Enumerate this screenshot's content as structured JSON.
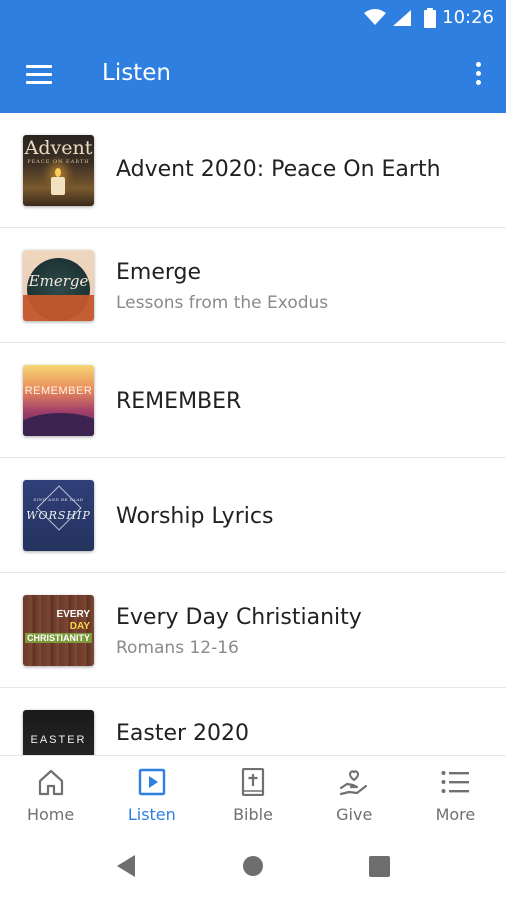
{
  "status_bar": {
    "time": "10:26"
  },
  "app_bar": {
    "title": "Listen",
    "menu_icon": "hamburger-menu-icon",
    "overflow_icon": "more-vert-icon"
  },
  "list": {
    "items": [
      {
        "title": "Advent 2020: Peace On Earth",
        "subtitle": "",
        "thumb_text": "Advent",
        "thumb_subtext": "PEACE ON EARTH"
      },
      {
        "title": "Emerge",
        "subtitle": "Lessons from the Exodus",
        "thumb_text": "Emerge"
      },
      {
        "title": "REMEMBER",
        "subtitle": "",
        "thumb_text": "REMEMBER"
      },
      {
        "title": "Worship Lyrics",
        "subtitle": "",
        "thumb_text": "WORSHIP",
        "thumb_subtext": "SING AND BE GLAD"
      },
      {
        "title": "Every Day Christianity",
        "subtitle": "Romans 12-16",
        "thumb_line1": "EVERY",
        "thumb_line2": "DAY",
        "thumb_line3": "CHRISTIANITY"
      },
      {
        "title": "Easter 2020",
        "subtitle": "",
        "thumb_text": "EASTER"
      }
    ]
  },
  "bottom_nav": {
    "tabs": [
      {
        "label": "Home",
        "icon": "home-icon",
        "active": false
      },
      {
        "label": "Listen",
        "icon": "play-box-icon",
        "active": true
      },
      {
        "label": "Bible",
        "icon": "bible-icon",
        "active": false
      },
      {
        "label": "Give",
        "icon": "give-hand-heart-icon",
        "active": false
      },
      {
        "label": "More",
        "icon": "list-icon",
        "active": false
      }
    ]
  },
  "colors": {
    "primary": "#2e7fe0",
    "active_tab": "#2e7fe0",
    "inactive_tab": "#707070",
    "title_text": "#212121",
    "subtitle_text": "#8a8a8a"
  }
}
